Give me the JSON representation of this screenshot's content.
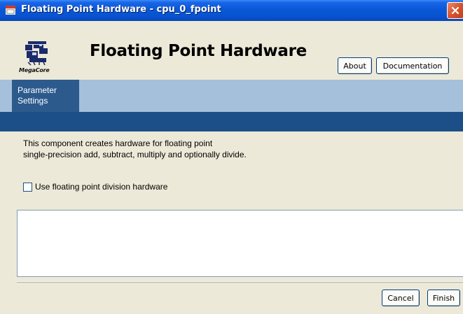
{
  "window": {
    "title": "Floating Point Hardware - cpu_0_fpoint"
  },
  "header": {
    "logo_text": "MegaCore",
    "title": "Floating Point Hardware",
    "about_label": "About",
    "documentation_label": "Documentation"
  },
  "tabs": [
    {
      "label": "Parameter Settings",
      "active": true
    }
  ],
  "content": {
    "description_line1": "This component creates hardware for floating point",
    "description_line2": "single-precision add, subtract, multiply and optionally divide.",
    "checkbox_label": "Use floating point division hardware",
    "checkbox_checked": false
  },
  "footer": {
    "cancel_label": "Cancel",
    "finish_label": "Finish"
  },
  "colors": {
    "titlebar": "#0a58d8",
    "tab_active": "#2c5a8d",
    "tab_strip": "#a5c0da",
    "navy_bar": "#1c4f87",
    "close_button": "#d8532e"
  },
  "icons": {
    "title_icon": "app-window-icon",
    "close_icon": "close-x-icon",
    "logo_icon": "megacore-logo-icon"
  }
}
